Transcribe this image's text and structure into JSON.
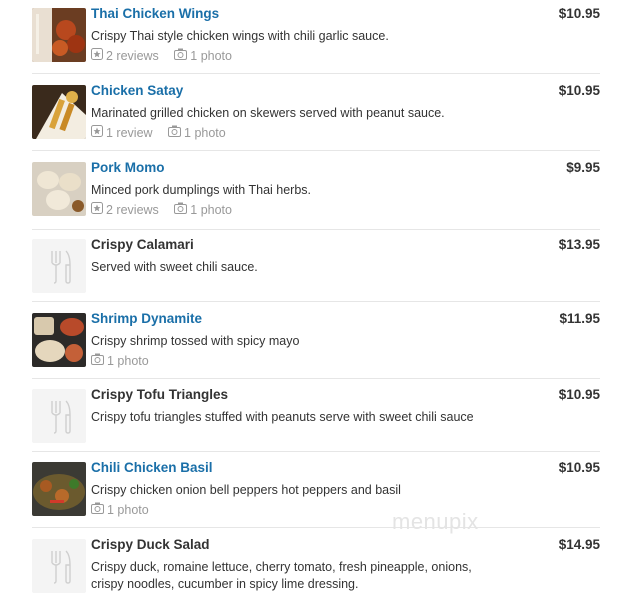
{
  "items": [
    {
      "name": "Thai Chicken Wings",
      "price": "$10.95",
      "desc": "Crispy Thai style chicken wings with chili garlic sauce.",
      "reviews": "2 reviews",
      "photos": "1 photo"
    },
    {
      "name": "Chicken Satay",
      "price": "$10.95",
      "desc": "Marinated grilled chicken on skewers served with peanut sauce.",
      "reviews": "1 review",
      "photos": "1 photo"
    },
    {
      "name": "Pork Momo",
      "price": "$9.95",
      "desc": "Minced pork dumplings with Thai herbs.",
      "reviews": "2 reviews",
      "photos": "1 photo"
    },
    {
      "name": "Crispy Calamari",
      "price": "$13.95",
      "desc": "Served with sweet chili sauce."
    },
    {
      "name": "Shrimp Dynamite",
      "price": "$11.95",
      "desc": "Crispy shrimp tossed with spicy mayo",
      "photos": "1 photo"
    },
    {
      "name": "Crispy Tofu Triangles",
      "price": "$10.95",
      "desc": "Crispy tofu triangles stuffed with peanuts serve with sweet chili sauce"
    },
    {
      "name": "Chili Chicken Basil",
      "price": "$10.95",
      "desc": "Crispy chicken onion bell peppers hot peppers and basil",
      "photos": "1 photo"
    },
    {
      "name": "Crispy Duck Salad",
      "price": "$14.95",
      "desc": "Crispy duck, romaine lettuce, cherry tomato, fresh pineapple, onions, crispy noodles, cucumber in spicy lime dressing."
    }
  ],
  "watermark": "menupix",
  "colors": {
    "link": "#1a6fa8",
    "text": "#333333",
    "meta": "#999999",
    "divider": "#e6e6e6"
  },
  "icons": {
    "review": "star-review-icon",
    "photo": "camera-icon",
    "placeholder": "fork-knife-icon"
  }
}
